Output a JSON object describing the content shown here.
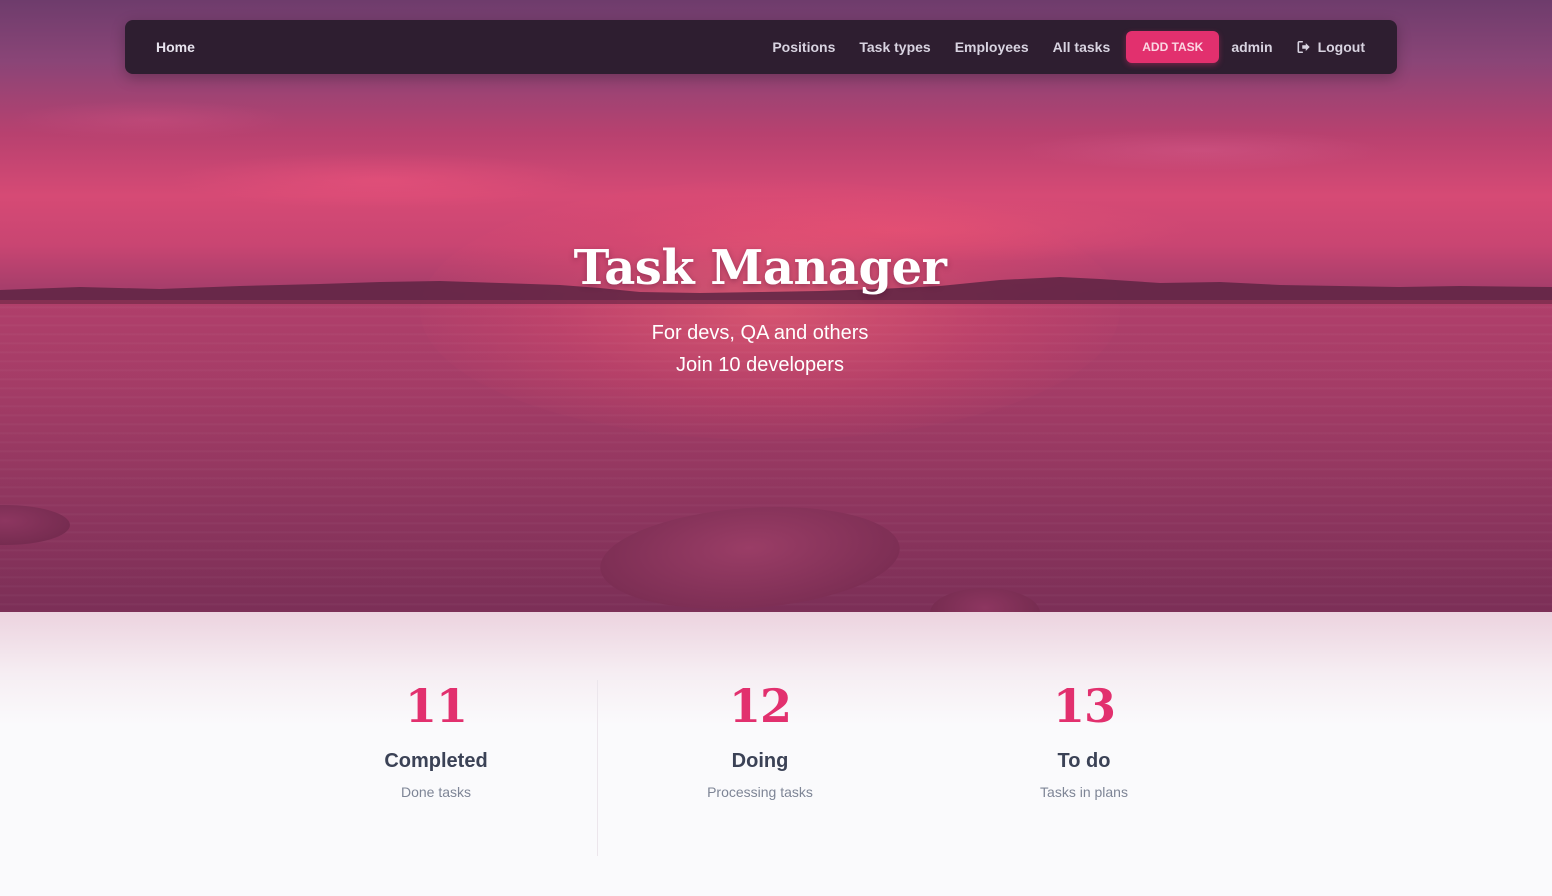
{
  "nav": {
    "home": "Home",
    "positions": "Positions",
    "task_types": "Task types",
    "employees": "Employees",
    "all_tasks": "All tasks",
    "add_task": "ADD TASK",
    "user": "admin",
    "logout": "Logout"
  },
  "hero": {
    "title": "Task Manager",
    "subtitle_1": "For devs, QA and others",
    "subtitle_2": "Join 10 developers"
  },
  "stats": [
    {
      "number": "11",
      "label": "Completed",
      "desc": "Done tasks"
    },
    {
      "number": "12",
      "label": "Doing",
      "desc": "Processing tasks"
    },
    {
      "number": "13",
      "label": "To do",
      "desc": "Tasks in plans"
    }
  ],
  "colors": {
    "accent": "#e2306e",
    "navbar": "#2e1e30",
    "stat_label": "#3b4256",
    "stat_desc": "#7e8596"
  },
  "icons": {
    "logout": "sign-out-icon"
  }
}
